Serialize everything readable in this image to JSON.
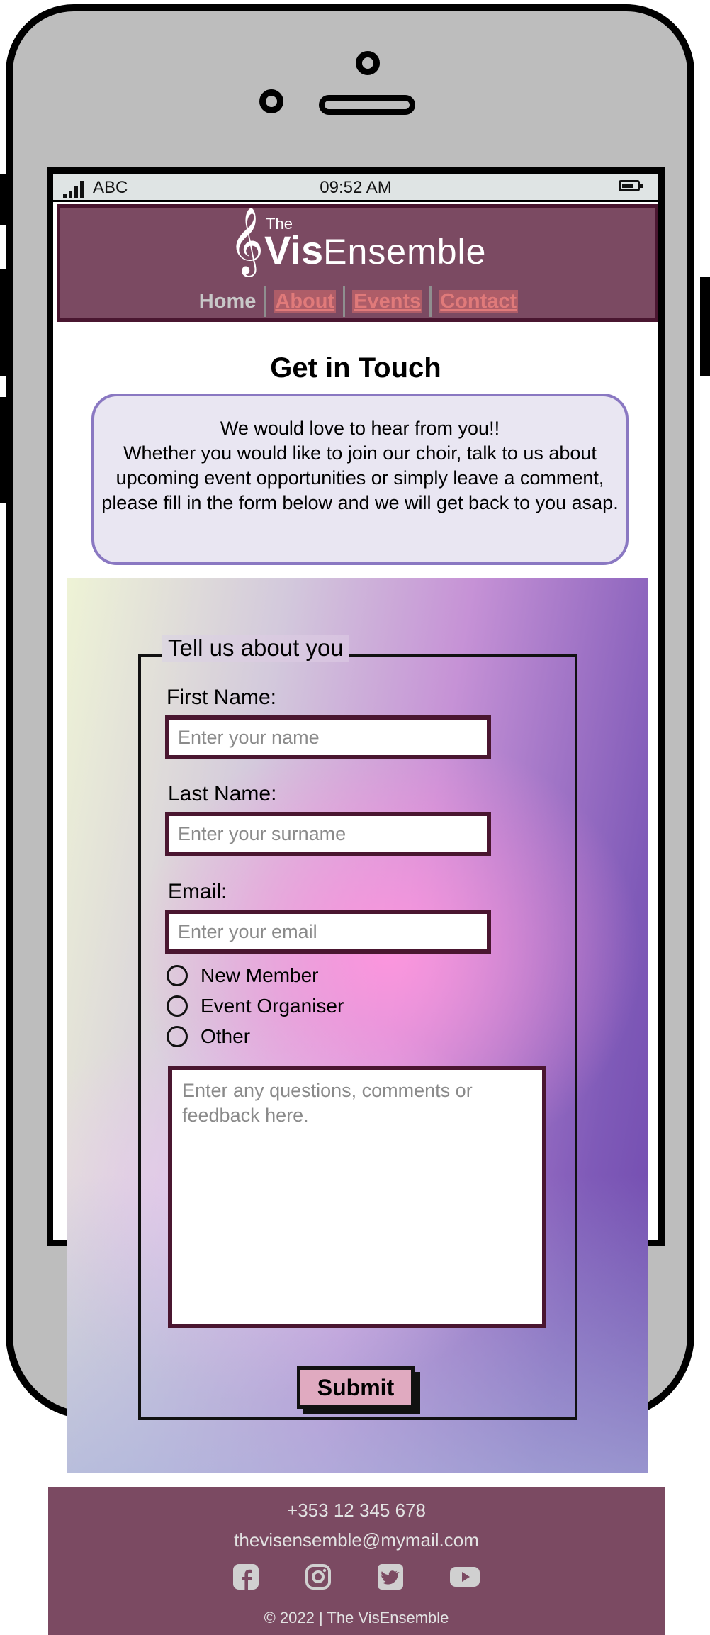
{
  "status_bar": {
    "carrier": "ABC",
    "time": "09:52 AM"
  },
  "header": {
    "logo": {
      "small": "The",
      "bold": "Vis",
      "rest": "Ensemble",
      "clef": "𝄞"
    },
    "nav": [
      {
        "label": "Home"
      },
      {
        "label": "About"
      },
      {
        "label": "Events"
      },
      {
        "label": "Contact"
      }
    ]
  },
  "page": {
    "title": "Get in Touch",
    "intro_line1": "We would love to hear from you!!",
    "intro_line2": "Whether you would like to join our choir, talk to us about upcoming event opportunities or simply leave a comment, please fill in the form below and we will get back to you asap."
  },
  "form": {
    "legend": "Tell us about you",
    "first_name_label": "First Name:",
    "first_name_placeholder": "Enter your name",
    "last_name_label": "Last Name:",
    "last_name_placeholder": "Enter your surname",
    "email_label": "Email:",
    "email_placeholder": "Enter your email",
    "options": [
      "New Member",
      "Event Organiser",
      "Other"
    ],
    "comments_placeholder": "Enter any questions, comments or feedback here.",
    "submit_label": "Submit"
  },
  "footer": {
    "phone": "+353 12 345 678",
    "email": "thevisensemble@mymail.com",
    "copyright": "© 2022 | The VisEnsemble",
    "social_icons": [
      "facebook-icon",
      "instagram-icon",
      "twitter-icon",
      "youtube-icon"
    ]
  },
  "colors": {
    "brand": "#7b4a62",
    "brand_border": "#4a1630",
    "intro_bg": "#e9e6f2",
    "intro_border": "#8a78c2",
    "submit_bg": "#e0aac0"
  }
}
